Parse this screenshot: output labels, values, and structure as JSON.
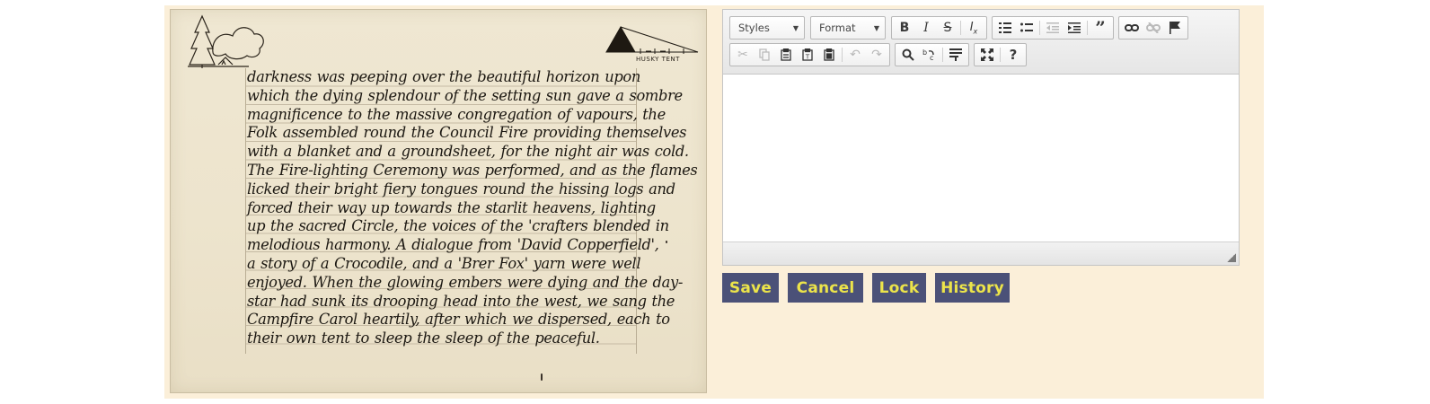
{
  "manuscript": {
    "label": "HUSKY TENT",
    "lines": [
      "darkness was peeping over the beautiful horizon upon",
      "which the dying splendour of the setting sun gave a sombre",
      "magnificence to the massive congregation of vapours, the",
      "Folk assembled round the Council Fire providing themselves",
      "with a blanket and a groundsheet, for the night air was cold.",
      "The Fire-lighting Ceremony was performed, and as the flames",
      "licked their bright fiery tongues round the hissing logs and",
      "forced their way up towards the starlit heavens, lighting",
      "up the sacred Circle, the voices of the 'crafters blended in",
      "melodious harmony. A dialogue from 'David Copperfield',",
      "a story of a Crocodile, and a 'Brer Fox' yarn were well",
      "enjoyed. When the glowing embers were dying and the day-",
      "star had sunk its drooping head into the west, we sang the",
      "Campfire Carol heartily, after which we dispersed, each to",
      "their own tent to sleep the sleep of the peaceful."
    ]
  },
  "editor": {
    "styles_label": "Styles",
    "format_label": "Format",
    "content": ""
  },
  "toolbar_icons": {
    "bold": "B",
    "italic": "I",
    "strike": "S",
    "remove_format": "Ix",
    "numbered_list": "numbered-list-icon",
    "bulleted_list": "bulleted-list-icon",
    "outdent": "outdent-icon",
    "indent": "indent-icon",
    "blockquote": "quote-icon",
    "link": "link-icon",
    "unlink": "unlink-icon",
    "anchor": "flag-icon",
    "cut": "scissors-icon",
    "copy": "copy-icon",
    "paste": "paste-icon",
    "paste_text": "paste-text-icon",
    "paste_word": "paste-word-icon",
    "undo": "undo-icon",
    "redo": "redo-icon",
    "find": "search-icon",
    "replace": "replace-icon",
    "select_all": "select-all-icon",
    "maximize": "maximize-icon",
    "help": "?"
  },
  "actions": {
    "save": "Save",
    "cancel": "Cancel",
    "lock": "Lock",
    "history": "History"
  },
  "colors": {
    "app_background": "#fbefd9",
    "button_background": "#4b5178",
    "button_text": "#ece44a"
  }
}
